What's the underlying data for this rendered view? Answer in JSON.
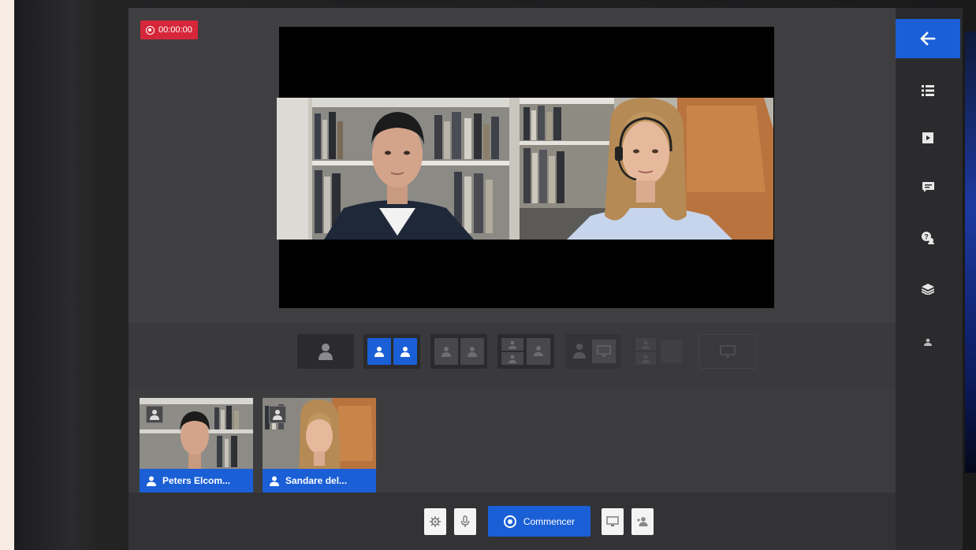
{
  "recording": {
    "timer": "00:00:00"
  },
  "participants": [
    {
      "name": "Peters Elcom..."
    },
    {
      "name": "Sandare del..."
    }
  ],
  "layouts": [
    {
      "id": "single",
      "state": "dark"
    },
    {
      "id": "side-by-side",
      "state": "selected"
    },
    {
      "id": "side-by-side-muted",
      "state": "disabled"
    },
    {
      "id": "grid-three",
      "state": "disabled"
    },
    {
      "id": "person-screen",
      "state": "disabled"
    },
    {
      "id": "grid-screen",
      "state": "faded"
    },
    {
      "id": "screen-only",
      "state": "faded"
    }
  ],
  "toolbar": {
    "start_label": "Commencer"
  },
  "sidebar": {
    "items": [
      "back-icon",
      "list-icon",
      "media-icon",
      "chat-icon",
      "qa-icon",
      "layers-icon",
      "participant-icon"
    ]
  },
  "colors": {
    "accent": "#1a5fd6",
    "record": "#d6273a"
  }
}
